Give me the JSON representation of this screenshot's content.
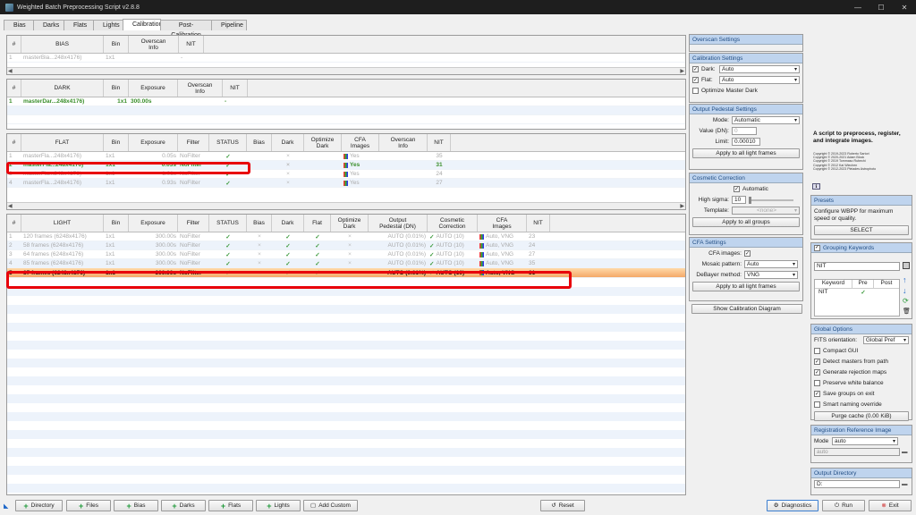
{
  "window": {
    "title": "Weighted Batch Preprocessing Script v2.8.8"
  },
  "tabs": [
    "Bias",
    "Darks",
    "Flats",
    "Lights",
    "Calibration",
    "Post-Calibration",
    "Pipeline"
  ],
  "bias": {
    "headers": [
      "#",
      "BIAS",
      "Bin",
      "Overscan\nInfo",
      "NIT"
    ],
    "rows": [
      [
        "1",
        "masterBia...248x4176)",
        "1x1",
        "",
        "-"
      ]
    ]
  },
  "dark": {
    "headers": [
      "#",
      "DARK",
      "Bin",
      "Exposure",
      "Overscan\nInfo",
      "NIT"
    ],
    "rows": [
      [
        "1",
        "masterDar...248x4176)",
        "1x1",
        "300.00s",
        "",
        "-"
      ]
    ]
  },
  "flat": {
    "headers": [
      "#",
      "FLAT",
      "Bin",
      "Exposure",
      "Filter",
      "STATUS",
      "Bias",
      "Dark",
      "Optimize\nDark",
      "CFA\nImages",
      "Overscan\nInfo",
      "NIT"
    ],
    "rows": [
      [
        "1",
        "masterFla...248x4176)",
        "1x1",
        "0.05s",
        "NoFilter",
        "✓",
        "",
        "×",
        "",
        "Yes",
        "",
        "35"
      ],
      [
        "2",
        "masterFla...248x4176)",
        "1x1",
        "0.03s",
        "NoFilter",
        "✓",
        "",
        "×",
        "",
        "Yes",
        "",
        "31"
      ],
      [
        "3",
        "masterFla...248x4176)",
        "1x1",
        "1.01s",
        "NoFilter",
        "✓",
        "",
        "×",
        "",
        "Yes",
        "",
        "24"
      ],
      [
        "4",
        "masterFla...248x4176)",
        "1x1",
        "0.93s",
        "NoFilter",
        "✓",
        "",
        "×",
        "",
        "Yes",
        "",
        "27"
      ]
    ]
  },
  "light": {
    "headers": [
      "#",
      "LIGHT",
      "Bin",
      "Exposure",
      "Filter",
      "STATUS",
      "Bias",
      "Dark",
      "Flat",
      "Optimize\nDark",
      "Output\nPedestal (DN)",
      "Cosmetic\nCorrection",
      "CFA\nImages",
      "NIT"
    ],
    "rows": [
      [
        "1",
        "120 frames (6248x4176)",
        "1x1",
        "300.00s",
        "NoFilter",
        "✓",
        "×",
        "✓",
        "✓",
        "×",
        "AUTO (0.01%)",
        "AUTO (10)",
        "Auto, VNG",
        "23"
      ],
      [
        "2",
        "58 frames (6248x4176)",
        "1x1",
        "300.00s",
        "NoFilter",
        "✓",
        "×",
        "✓",
        "✓",
        "×",
        "AUTO (0.01%)",
        "AUTO (10)",
        "Auto, VNG",
        "24"
      ],
      [
        "3",
        "64 frames (6248x4176)",
        "1x1",
        "300.00s",
        "NoFilter",
        "✓",
        "×",
        "✓",
        "✓",
        "×",
        "AUTO (0.01%)",
        "AUTO (10)",
        "Auto, VNG",
        "27"
      ],
      [
        "4",
        "85 frames (6248x4176)",
        "1x1",
        "300.00s",
        "NoFilter",
        "✓",
        "×",
        "✓",
        "✓",
        "×",
        "AUTO (0.01%)",
        "AUTO (10)",
        "Auto, VNG",
        "35"
      ],
      [
        "5",
        "87 frames (6248x4176)",
        "1x1",
        "300.00s",
        "NoFilter",
        "✓",
        "×",
        "✓",
        "✓",
        "×",
        "AUTO (0.01%)",
        "AUTO (10)",
        "Auto, VNG",
        "31"
      ]
    ]
  },
  "overscan": {
    "title": "Overscan Settings"
  },
  "calibration": {
    "title": "Calibration Settings",
    "dark_label": "Dark:",
    "dark_value": "Auto",
    "flat_label": "Flat:",
    "flat_value": "Auto",
    "optimize_label": "Optimize Master Dark"
  },
  "pedestal": {
    "title": "Output Pedestal Settings",
    "mode_label": "Mode:",
    "mode_value": "Automatic",
    "value_label": "Value (DN):",
    "value_value": "0",
    "limit_label": "Limit:",
    "limit_value": "0.00010",
    "apply": "Apply to all light frames"
  },
  "cosmetic": {
    "title": "Cosmetic Correction",
    "automatic": "Automatic",
    "sigma_label": "High sigma:",
    "sigma_value": "10",
    "template_label": "Template:",
    "template_value": "<none>",
    "apply": "Apply to all groups"
  },
  "cfa": {
    "title": "CFA Settings",
    "images_label": "CFA images:",
    "mosaic_label": "Mosaic pattern:",
    "mosaic_value": "Auto",
    "debayer_label": "DeBayer method:",
    "debayer_value": "VNG",
    "apply": "Apply to all light frames"
  },
  "show_diagram": "Show Calibration Diagram",
  "description": "A script to preprocess, register, and integrate images.",
  "credits": [
    "Copyright © 2019-2023 Roberto Sartori",
    "Copyright © 2020-2021 Adam Block",
    "Copyright © 2019 Tommaso Rubechi",
    "Copyright © 2012 Kai Wiechen",
    "Copyright © 2012-2023 Pleiades Astrophoto"
  ],
  "presets": {
    "title": "Presets",
    "text": "Configure WBPP for maximum speed or quality.",
    "select": "SELECT"
  },
  "grouping": {
    "title": "Grouping Keywords",
    "input": "NIT",
    "headers": [
      "Keyword",
      "Pre",
      "Post"
    ],
    "rows": [
      [
        "NIT",
        "✓",
        ""
      ]
    ]
  },
  "global": {
    "title": "Global Options",
    "fits_label": "FITS orientation:",
    "fits_value": "Global Pref",
    "options": [
      {
        "label": "Compact GUI",
        "checked": false
      },
      {
        "label": "Detect masters from path",
        "checked": true
      },
      {
        "label": "Generate rejection maps",
        "checked": true
      },
      {
        "label": "Preserve white balance",
        "checked": false
      },
      {
        "label": "Save groups on exit",
        "checked": true
      },
      {
        "label": "Smart naming override",
        "checked": false
      }
    ],
    "purge": "Purge cache (0.00 KiB)"
  },
  "registration": {
    "title": "Registration Reference Image",
    "mode_label": "Mode",
    "mode_value": "auto",
    "value": "auto"
  },
  "output": {
    "title": "Output Directory",
    "value": "D:"
  },
  "bottom": {
    "directory": "Directory",
    "files": "Files",
    "bias": "Bias",
    "darks": "Darks",
    "flats": "Flats",
    "lights": "Lights",
    "custom": "Add Custom",
    "reset": "Reset",
    "diagnostics": "Diagnostics",
    "run": "Run",
    "exit": "Exit"
  }
}
